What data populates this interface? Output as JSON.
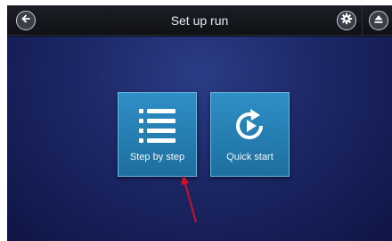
{
  "header": {
    "title": "Set up run",
    "back_icon": "arrow-left-circle-icon",
    "settings_icon": "gear-icon",
    "eject_icon": "eject-icon"
  },
  "main": {
    "tiles": [
      {
        "label": "Step by step",
        "icon": "list-icon"
      },
      {
        "label": "Quick start",
        "icon": "play-refresh-icon"
      }
    ]
  },
  "colors": {
    "tile": "#2683b6",
    "background": "#1c2766",
    "header": "#15181d"
  }
}
